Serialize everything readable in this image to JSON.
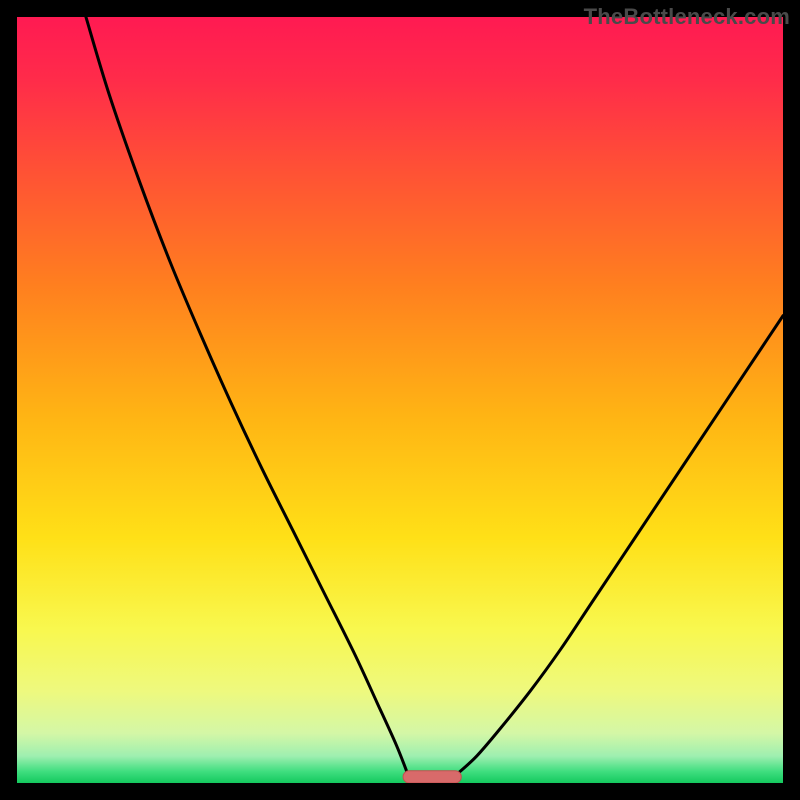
{
  "watermark": "TheBottleneck.com",
  "colors": {
    "frame": "#000000",
    "gradient_stops": [
      {
        "offset": 0.0,
        "color": "#ff1a52"
      },
      {
        "offset": 0.08,
        "color": "#ff2b4a"
      },
      {
        "offset": 0.2,
        "color": "#ff5135"
      },
      {
        "offset": 0.35,
        "color": "#ff7f1f"
      },
      {
        "offset": 0.52,
        "color": "#ffb414"
      },
      {
        "offset": 0.68,
        "color": "#ffe017"
      },
      {
        "offset": 0.8,
        "color": "#f8f84f"
      },
      {
        "offset": 0.88,
        "color": "#eef97e"
      },
      {
        "offset": 0.935,
        "color": "#d4f7a6"
      },
      {
        "offset": 0.965,
        "color": "#9eefb0"
      },
      {
        "offset": 0.985,
        "color": "#3fde7f"
      },
      {
        "offset": 1.0,
        "color": "#14c95e"
      }
    ],
    "curve_stroke": "#000000",
    "marker_fill": "#d86a6a",
    "marker_stroke": "#c24f4f"
  },
  "chart_data": {
    "type": "line",
    "title": "",
    "xlabel": "",
    "ylabel": "",
    "xlim": [
      0,
      100
    ],
    "ylim": [
      0,
      100
    ],
    "grid": false,
    "note": "Axes are not labeled in the source image; x/y treated as 0–100 percent of plot area (x left→right, y bottom→top). Values are estimated from pixel positions.",
    "series": [
      {
        "name": "left-branch",
        "x": [
          9.0,
          12.0,
          16.0,
          20.0,
          24.0,
          28.0,
          32.0,
          36.0,
          40.0,
          44.0,
          47.0,
          49.5,
          51.0
        ],
        "y": [
          100.0,
          90.0,
          78.5,
          68.0,
          58.5,
          49.5,
          41.0,
          33.0,
          25.0,
          17.0,
          10.5,
          5.0,
          1.2
        ]
      },
      {
        "name": "right-branch",
        "x": [
          57.5,
          60.0,
          63.0,
          67.0,
          71.0,
          75.0,
          79.0,
          83.0,
          87.0,
          91.0,
          95.0,
          98.0,
          100.0
        ],
        "y": [
          1.2,
          3.5,
          7.0,
          12.0,
          17.5,
          23.5,
          29.5,
          35.5,
          41.5,
          47.5,
          53.5,
          58.0,
          61.0
        ]
      }
    ],
    "marker": {
      "name": "bottleneck-point",
      "shape": "rounded-bar",
      "x_center": 54.2,
      "y_center": 0.8,
      "width": 7.6,
      "height": 1.6
    }
  }
}
